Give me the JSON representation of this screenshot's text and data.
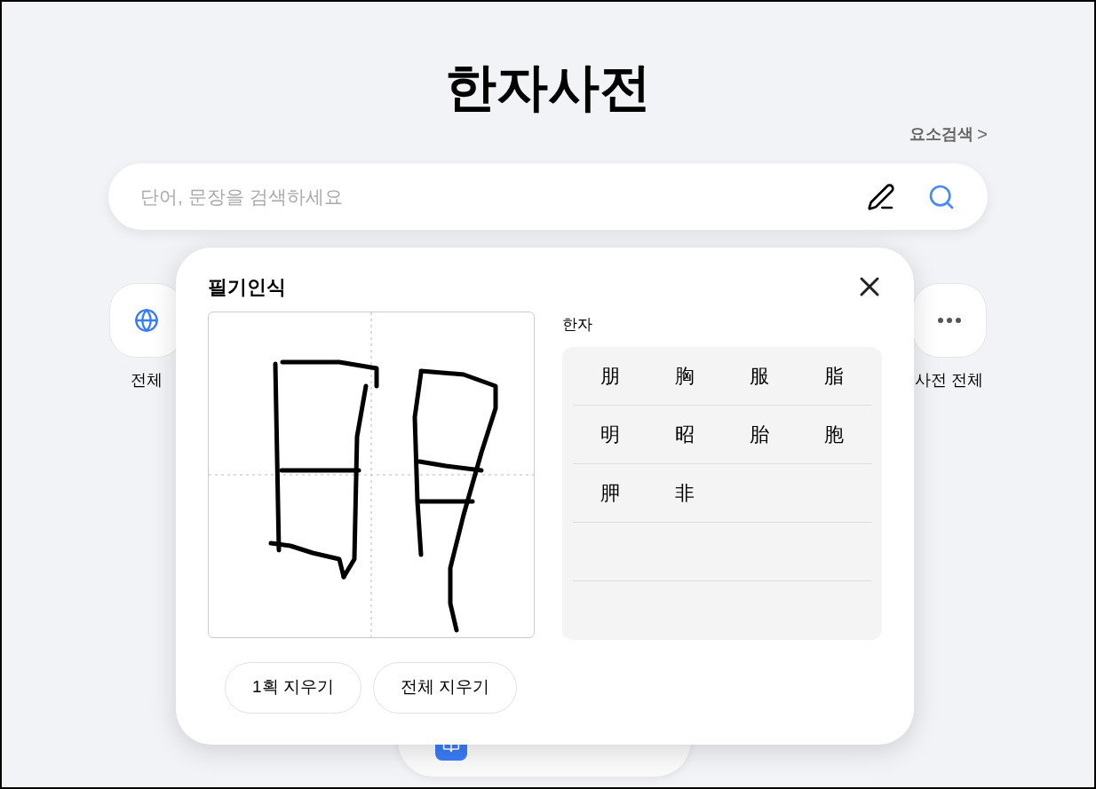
{
  "page": {
    "title": "한자사전",
    "element_search_link": "요소검색",
    "link_arrow": ">"
  },
  "search": {
    "placeholder": "단어, 문장을 검색하세요"
  },
  "categories": [
    {
      "kind": "globe",
      "label": "전체"
    },
    {
      "kind": "more",
      "label": "사전 전체"
    }
  ],
  "bottom_button": {
    "kind": "book"
  },
  "handwriting_panel": {
    "title": "필기인식",
    "candidates_label": "한자",
    "candidate_rows": [
      [
        "朋",
        "胸",
        "服",
        "脂"
      ],
      [
        "明",
        "昭",
        "胎",
        "胞"
      ],
      [
        "胛",
        "非"
      ],
      [],
      []
    ],
    "buttons": [
      "1획 지우기",
      "전체 지우기"
    ]
  }
}
